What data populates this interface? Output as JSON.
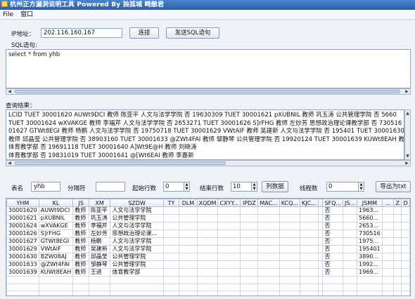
{
  "window": {
    "title": "杭州正方漏洞说明工具 Powered By 独孤城 畸酿君"
  },
  "menu": {
    "items": [
      "File",
      "窗口"
    ]
  },
  "connection": {
    "ip_label": "IP地址：",
    "ip_value": "202.116.160.167",
    "connect_label": "连接",
    "send_sql_label": "发送SQL语句"
  },
  "sql": {
    "label": "SQL语句:",
    "text": "select * from yhb"
  },
  "result": {
    "label": "查询结果：",
    "lines": [
      "LCID          TUET   30001620 AUWt9DCI 教师 陈亚平 人文与法学学院 否 19630309   TUET   30001621 pXUBNIL 教师 巩玉涛 公共管理学院 否 5660",
      "TUET  30001624 wXVAKGE 教师 李福芹 人文与法学学院 否 2653271   TUET   30001626 S]rFHG 教师 左妙芳 思想政治理论课教学部 否 730516   TUET   300",
      "01627 GTWt8EGI 教师 杨鹏 人文与法学学院 否 19750718   TUET   30001629 VWtAIF 教师 吴建新 人文与法学学院 否 195401   TUET   30001630 BZW08AJ",
      "教师 邱晶莹 公共管理学院 否 38903160  TUET   30001633 @ZWt4FAI 教师 邹静琴 公共管理学院 否 19920124  TUET   30001639 KUWt8EAH 教师 王进",
      "体育教学部 否 19691118   TUET   30001640 A]Wt9E@H 教师 刘晓涛",
      "体育教学部 否 19831019   TUET   30001641 @[Wt6EAI 教师 李嘉新"
    ]
  },
  "controls": {
    "table_label": "表名",
    "table_value": "yhb",
    "sep_label": "分隔符",
    "sep_value": "",
    "start_label": "起始行数",
    "start_value": "0",
    "end_label": "结束行数",
    "end_value": "10",
    "list_data_label": "列数据",
    "threads_label": "线程数",
    "threads_value": "0",
    "export_label": "导出为txt"
  },
  "grid": {
    "columns": [
      "YHM",
      "KL",
      "JS",
      "XM",
      "SZDW",
      "TY",
      "DLM",
      "XQDM",
      "CXYY...",
      "IPDZ",
      "MAC...",
      "KCQ...",
      "KJC...",
      "",
      "SFQ...",
      "JS...",
      "JSMM",
      "...",
      "Z",
      "D"
    ],
    "rows": [
      [
        "30001620",
        "AUWt9DCI",
        "教师",
        "陈亚平",
        "人文与法学学院",
        "",
        "",
        "",
        "",
        "",
        "",
        "",
        "",
        "",
        "否",
        "",
        "1963...",
        "",
        "",
        ""
      ],
      [
        "30001621",
        "pXUBNIL",
        "教师",
        "巩玉涛",
        "公共管理学院",
        "",
        "",
        "",
        "",
        "",
        "",
        "",
        "",
        "",
        "否",
        "",
        "5660...",
        "",
        "",
        ""
      ],
      [
        "30001624",
        "wXVAKGE",
        "教师",
        "李福芹",
        "人文与法学学院",
        "",
        "",
        "",
        "",
        "",
        "",
        "",
        "",
        "",
        "否",
        "",
        "2653...",
        "",
        "",
        ""
      ],
      [
        "30001626",
        "S]rFHG",
        "教师",
        "左妙芳",
        "思想政治理论课...",
        "",
        "",
        "",
        "",
        "",
        "",
        "",
        "",
        "",
        "否",
        "",
        "730516",
        "",
        "",
        ""
      ],
      [
        "30001627",
        "GTWt8EGI",
        "教师",
        "杨鹏",
        "人文与法学学院",
        "",
        "",
        "",
        "",
        "",
        "",
        "",
        "",
        "",
        "否",
        "",
        "1975...",
        "",
        "",
        ""
      ],
      [
        "30001629",
        "VWtAIF",
        "教师",
        "吴建新",
        "人文与法学学院",
        "",
        "",
        "",
        "",
        "",
        "",
        "",
        "",
        "",
        "否",
        "",
        "195401",
        "",
        "",
        ""
      ],
      [
        "30001630",
        "BZW08AJ",
        "教师",
        "邱晶莹",
        "公共管理学院",
        "",
        "",
        "",
        "",
        "",
        "",
        "",
        "",
        "",
        "否",
        "",
        "3890...",
        "",
        "",
        ""
      ],
      [
        "30001633",
        "@ZWt4FAI",
        "教师",
        "邹静琴",
        "公共管理学院",
        "",
        "",
        "",
        "",
        "",
        "",
        "",
        "",
        "",
        "否",
        "",
        "1992...",
        "",
        "",
        ""
      ],
      [
        "30001639",
        "KUWt8EAH",
        "教师",
        "王进",
        "体育教学部",
        "",
        "",
        "",
        "",
        "",
        "",
        "",
        "",
        "",
        "否",
        "",
        "1969...",
        "",
        "",
        ""
      ],
      [
        "",
        "",
        "",
        "",
        "",
        "",
        "",
        "",
        "",
        "",
        "",
        "",
        "",
        "",
        "",
        "",
        "",
        "",
        "",
        ""
      ],
      [
        "",
        "",
        "",
        "",
        "",
        "",
        "",
        "",
        "",
        "",
        "",
        "",
        "",
        "",
        "",
        "",
        "",
        "",
        "",
        ""
      ],
      [
        "",
        "",
        "",
        "",
        "",
        "",
        "",
        "",
        "",
        "",
        "",
        "",
        "",
        "",
        "",
        "",
        "",
        "",
        "",
        ""
      ]
    ]
  }
}
